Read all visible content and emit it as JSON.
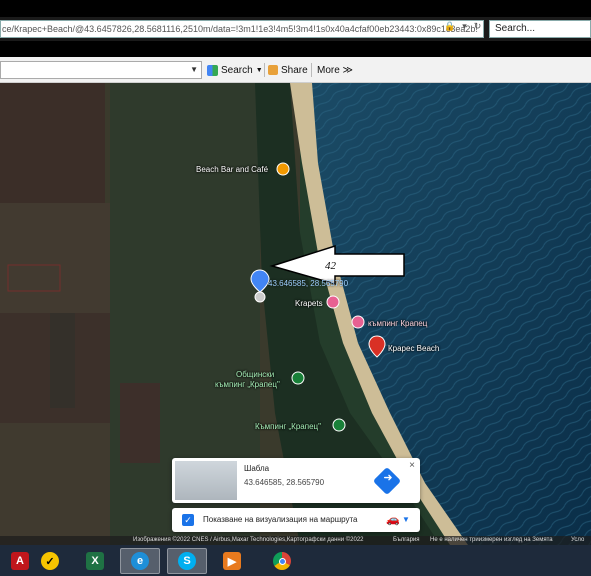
{
  "browser": {
    "url": "ce/Кrapec+Beach/@43.6457826,28.5681116,2510m/data=!3m1!1e3!4m5!3m4!1s0x40a4cfaf00eb23443:0x89c1c3ea2b!",
    "search_placeholder": "Search...",
    "toolbar": {
      "search_label": "Search",
      "share_label": "Share",
      "more_label": "More ≫"
    }
  },
  "map": {
    "labels": {
      "beach_bar": "Beach Bar and Café",
      "krapets": "Krapets",
      "camping_krapets_1": "къмпинг Крапец",
      "krapec_beach": "Крарес Beach",
      "municipal_camping_line1": "Общински",
      "municipal_camping_line2": "къмпинг „Крапец\"",
      "camping_krapets_2": "Къмпинг „Крапец\"",
      "coord_label": "43.646585, 28.565790",
      "annotation_number": "42"
    }
  },
  "info_card": {
    "title": "Шабла",
    "coords": "43.646585, 28.565790",
    "close": "×",
    "route_checkbox_label": "Показване на визуализация на маршрута"
  },
  "attribution": {
    "imagery": "Изображения ©2022 CNES / Airbus,Maxar Technologies,Картографски данни ©2022",
    "country": "България",
    "notice": "Не е наличен триизмерен изглед на Земята",
    "more": "Усло"
  },
  "taskbar": {
    "items": [
      "acrobat",
      "norton",
      "excel",
      "internet-explorer",
      "skype",
      "media-player",
      "chrome"
    ]
  },
  "colors": {
    "sea": "#0f3a5a",
    "sand": "#d7c7a0",
    "field": "#3d3a2e",
    "forest": "#1e3326",
    "accent_blue": "#1a73e8",
    "pin_red": "#d93025"
  }
}
